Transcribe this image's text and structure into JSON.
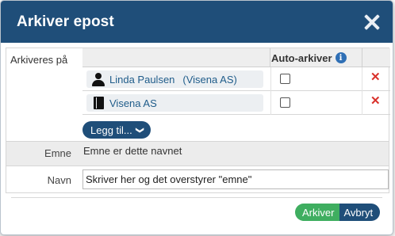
{
  "dialog": {
    "title": "Arkiver epost"
  },
  "archive": {
    "label": "Arkiveres på",
    "auto_header": "Auto-arkiver",
    "rows": [
      {
        "icon": "person-icon",
        "name": "Linda Paulsen",
        "org": "(Visena AS)",
        "auto": false
      },
      {
        "icon": "book-icon",
        "name": "Visena AS",
        "org": "",
        "auto": false
      }
    ],
    "add_label": "Legg til..."
  },
  "emne": {
    "label": "Emne",
    "value": "Emne er dette navnet"
  },
  "navn": {
    "label": "Navn",
    "value": "Skriver her og det overstyrer \"emne\""
  },
  "buttons": {
    "archive": "Arkiver",
    "cancel": "Avbryt"
  },
  "colors": {
    "header": "#1f4e79",
    "archive_button": "#3fae60",
    "delete": "#d9312b",
    "info": "#2f6fb5"
  }
}
